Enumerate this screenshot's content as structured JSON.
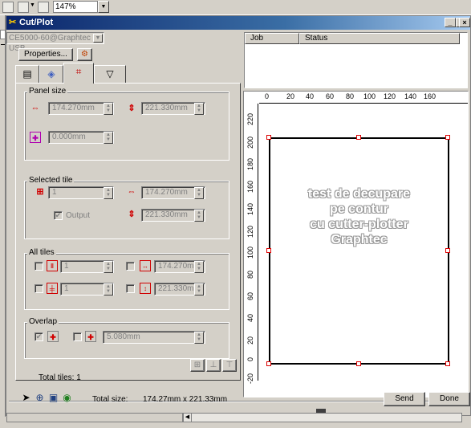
{
  "app_toolbar": {
    "zoom_value": "147%"
  },
  "dialog": {
    "title": "Cut/Plot",
    "title_buttons": [
      "_",
      "□",
      "×"
    ],
    "device": "CE5000-60@Graphtec USB",
    "properties_label": "Properties...",
    "tabs": [
      "general",
      "weed",
      "tiling",
      "knife"
    ],
    "job_list": {
      "columns": [
        "Job",
        "Status"
      ],
      "rows": []
    },
    "panel_size": {
      "label": "Panel size",
      "width": "174.270mm",
      "height": "221.330mm",
      "offset": "0.000mm"
    },
    "selected_tile": {
      "label": "Selected tile",
      "index": "1",
      "width": "174.270mm",
      "height": "221.330mm",
      "output_label": "Output",
      "output_checked": true
    },
    "all_tiles": {
      "label": "All tiles",
      "cols": "1",
      "rows": "1",
      "width": "174.270m",
      "height": "221.330m"
    },
    "overlap": {
      "label": "Overlap",
      "value": "5.080mm",
      "checked": true
    },
    "total_tiles_label": "Total tiles: 1",
    "preview": {
      "ruler_top": [
        "0",
        "20",
        "40",
        "60",
        "80",
        "100",
        "120",
        "140",
        "160"
      ],
      "ruler_left": [
        "220",
        "200",
        "180",
        "160",
        "140",
        "120",
        "100",
        "80",
        "60",
        "40",
        "20",
        "0",
        "-20"
      ],
      "text_lines": [
        "test de decupare",
        "pe contur",
        "cu cutter-plotter",
        "Graphtec"
      ]
    },
    "bottom": {
      "total_size_label": "Total size:",
      "total_size_value": "174.27mm x 221.33mm",
      "send_label": "Send",
      "done_label": "Done"
    }
  }
}
